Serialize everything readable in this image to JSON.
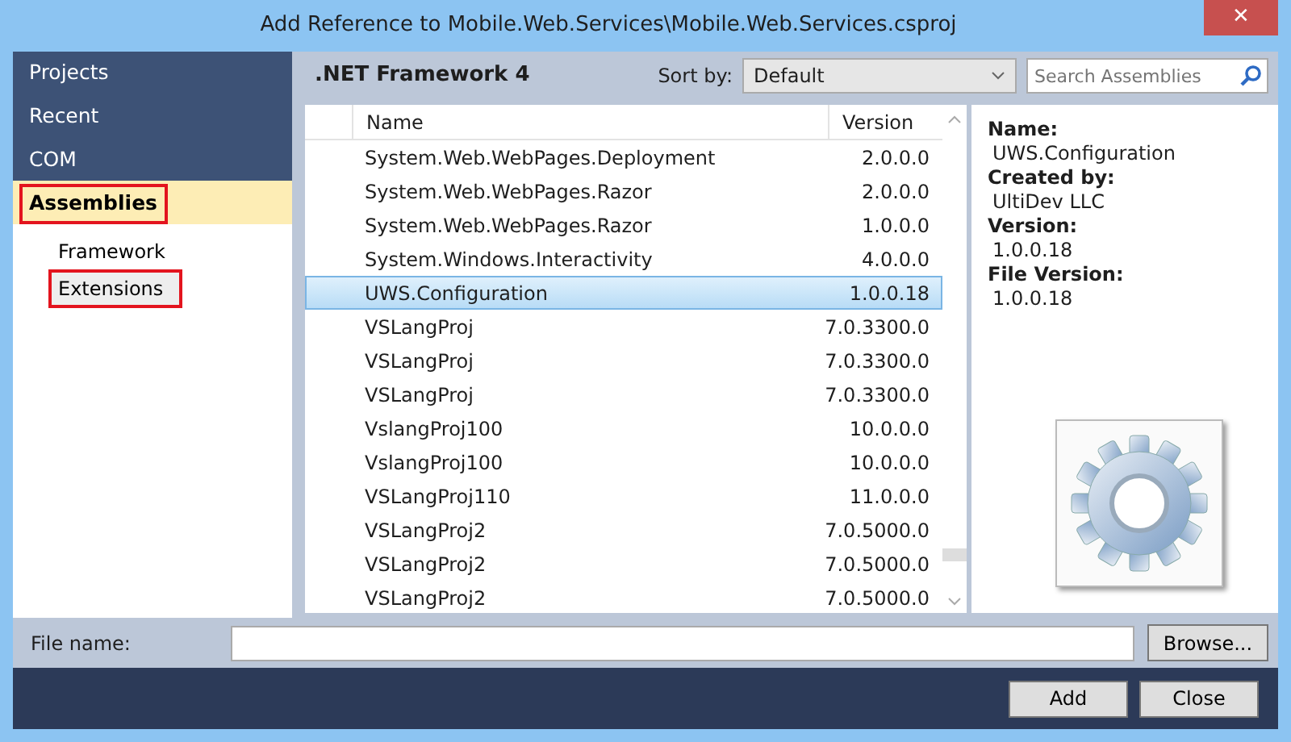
{
  "window": {
    "title": "Add Reference to Mobile.Web.Services\\Mobile.Web.Services.csproj",
    "close": "✕"
  },
  "sidebar": {
    "items": [
      {
        "label": "Projects",
        "selected": false,
        "highlighted": false
      },
      {
        "label": "Recent",
        "selected": false,
        "highlighted": false
      },
      {
        "label": "COM",
        "selected": false,
        "highlighted": false
      },
      {
        "label": "Assemblies",
        "selected": true,
        "highlighted": true,
        "children": [
          {
            "label": "Framework",
            "selected": false,
            "highlighted": false
          },
          {
            "label": "Extensions",
            "selected": true,
            "highlighted": true
          }
        ]
      }
    ]
  },
  "header": {
    "title": ".NET Framework 4",
    "sort_label": "Sort by:",
    "sort_value": "Default",
    "search": {
      "placeholder": "Search Assemblies"
    }
  },
  "table": {
    "columns": [
      "Name",
      "Version"
    ],
    "rows": [
      {
        "name": "System.Web.WebPages.Deployment",
        "version": "2.0.0.0",
        "selected": false
      },
      {
        "name": "System.Web.WebPages.Razor",
        "version": "2.0.0.0",
        "selected": false
      },
      {
        "name": "System.Web.WebPages.Razor",
        "version": "1.0.0.0",
        "selected": false
      },
      {
        "name": "System.Windows.Interactivity",
        "version": "4.0.0.0",
        "selected": false
      },
      {
        "name": "UWS.Configuration",
        "version": "1.0.0.18",
        "selected": true
      },
      {
        "name": "VSLangProj",
        "version": "7.0.3300.0",
        "selected": false
      },
      {
        "name": "VSLangProj",
        "version": "7.0.3300.0",
        "selected": false
      },
      {
        "name": "VSLangProj",
        "version": "7.0.3300.0",
        "selected": false
      },
      {
        "name": "VslangProj100",
        "version": "10.0.0.0",
        "selected": false
      },
      {
        "name": "VslangProj100",
        "version": "10.0.0.0",
        "selected": false
      },
      {
        "name": "VSLangProj110",
        "version": "11.0.0.0",
        "selected": false
      },
      {
        "name": "VSLangProj2",
        "version": "7.0.5000.0",
        "selected": false
      },
      {
        "name": "VSLangProj2",
        "version": "7.0.5000.0",
        "selected": false
      },
      {
        "name": "VSLangProj2",
        "version": "7.0.5000.0",
        "selected": false
      }
    ]
  },
  "details": [
    {
      "label": "Name:",
      "value": "UWS.Configuration"
    },
    {
      "label": "Created by:",
      "value": "UltiDev LLC"
    },
    {
      "label": "Version:",
      "value": "1.0.0.18"
    },
    {
      "label": "File Version:",
      "value": "1.0.0.18"
    }
  ],
  "file_name": {
    "label": "File name:",
    "button": "Browse..."
  },
  "buttons": [
    "Add",
    "Close"
  ]
}
